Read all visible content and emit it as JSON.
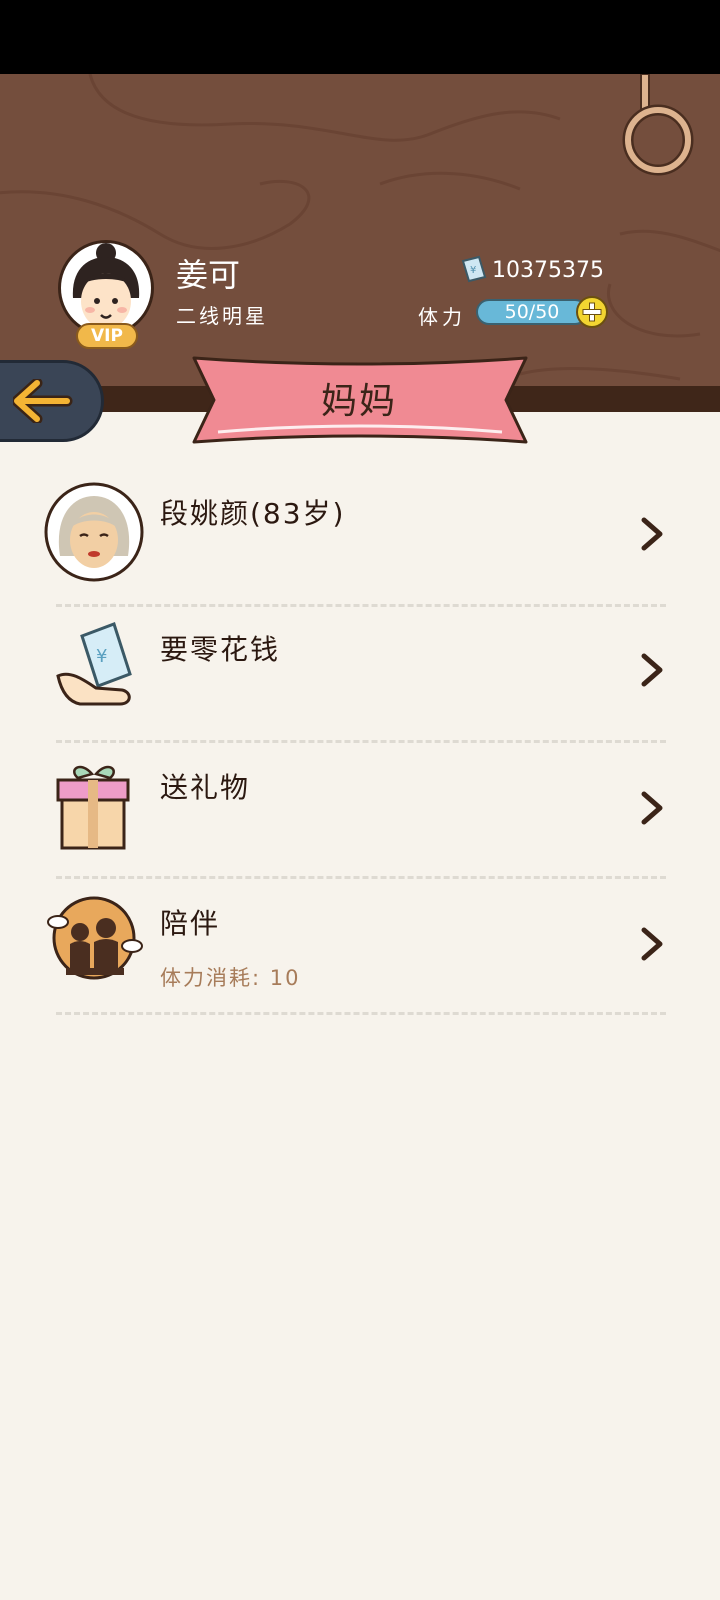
{
  "player": {
    "name": "姜可",
    "title": "二线明星",
    "vip_label": "VIP",
    "money": "10375375",
    "stamina_label": "体力",
    "stamina_value": "50/50"
  },
  "page": {
    "title": "妈妈"
  },
  "menu": [
    {
      "label": "段姚颜(83岁)",
      "icon": "grandmother-avatar-icon"
    },
    {
      "label": "要零花钱",
      "icon": "money-hand-icon"
    },
    {
      "label": "送礼物",
      "icon": "gift-box-icon"
    },
    {
      "label": "陪伴",
      "sub": "体力消耗: 10",
      "icon": "companion-silhouette-icon"
    }
  ],
  "colors": {
    "wood": "#744e3d",
    "banner": "#f08a93",
    "background": "#f7f3ec",
    "stamina_bar": "#68b8d8",
    "back_button": "#3a4556",
    "back_arrow": "#f4b434"
  }
}
